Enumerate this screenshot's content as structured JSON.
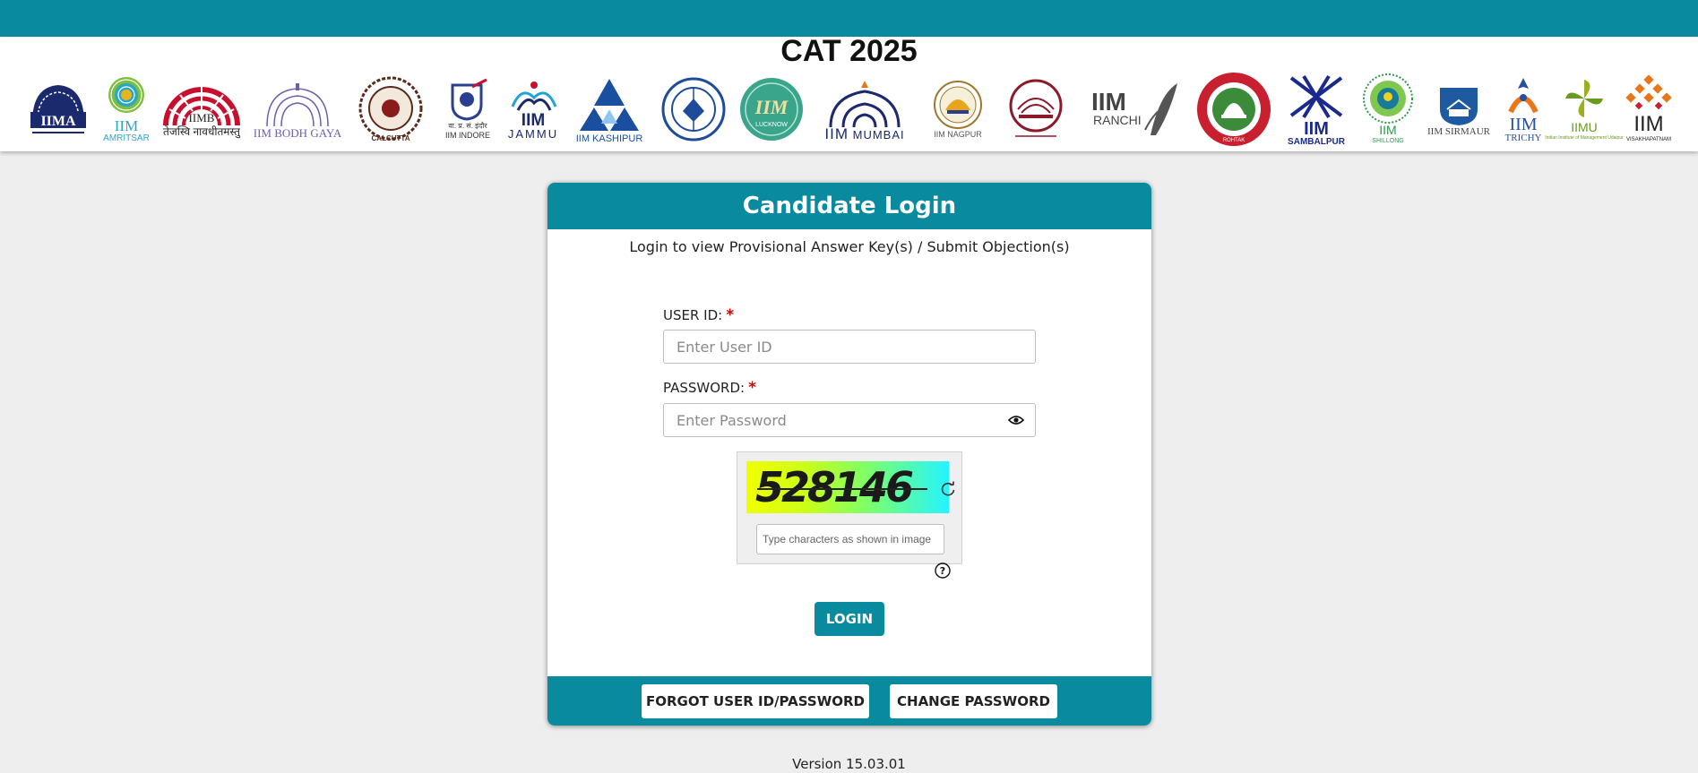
{
  "header": {
    "title": "CAT 2025",
    "logos": [
      {
        "name": "iima-logo",
        "text": "IIMA",
        "caption": ""
      },
      {
        "name": "iim-amritsar-logo",
        "text": "IIM",
        "caption": "AMRITSAR"
      },
      {
        "name": "iimb-logo",
        "text": "IIMB",
        "caption": "तेजस्वि नावधीतमस्तु"
      },
      {
        "name": "iim-bodh-gaya-logo",
        "text": "IIM BODH GAYA",
        "caption": ""
      },
      {
        "name": "iim-calcutta-logo",
        "text": "",
        "caption": "CALCUTTA"
      },
      {
        "name": "iim-indore-logo",
        "text": "",
        "caption": "IIM INDORE"
      },
      {
        "name": "iim-jammu-logo",
        "text": "IIM",
        "caption": "JAMMU"
      },
      {
        "name": "iim-kashipur-logo",
        "text": "",
        "caption": "IIM KASHIPUR"
      },
      {
        "name": "iim-kozhikode-logo",
        "text": "",
        "caption": ""
      },
      {
        "name": "iim-lucknow-logo",
        "text": "IIM",
        "caption": "LUCKNOW"
      },
      {
        "name": "iim-mumbai-logo",
        "text": "IIM",
        "caption": "MUMBAI"
      },
      {
        "name": "iim-nagpur-logo",
        "text": "",
        "caption": "IIM NAGPUR"
      },
      {
        "name": "iim-raipur-logo",
        "text": "",
        "caption": ""
      },
      {
        "name": "iim-ranchi-logo",
        "text": "IIM",
        "caption": "RANCHI"
      },
      {
        "name": "iim-rohtak-logo",
        "text": "",
        "caption": "ROHTAK"
      },
      {
        "name": "iim-sambalpur-logo",
        "text": "IIM",
        "caption": "SAMBALPUR"
      },
      {
        "name": "iim-shillong-logo",
        "text": "IIM",
        "caption": "SHILLONG"
      },
      {
        "name": "iim-sirmaur-logo",
        "text": "IIM SIRMAUR",
        "caption": ""
      },
      {
        "name": "iim-trichy-logo",
        "text": "IIM",
        "caption": "TRICHY"
      },
      {
        "name": "iim-udaipur-logo",
        "text": "IIMU",
        "caption": ""
      },
      {
        "name": "iim-visakhapatnam-logo",
        "text": "IIM",
        "caption": "VISAKHAPATNAM"
      }
    ]
  },
  "login": {
    "title": "Candidate Login",
    "subtitle": "Login to view Provisional Answer Key(s) / Submit Objection(s)",
    "user_id_label": "USER ID:",
    "user_id_placeholder": "Enter User ID",
    "password_label": "PASSWORD:",
    "password_placeholder": "Enter Password",
    "required_mark": "*",
    "captcha_value": "528146",
    "captcha_placeholder": "Type characters as shown in image",
    "login_button": "LOGIN",
    "forgot_button": "FORGOT USER ID/PASSWORD",
    "change_password_button": "CHANGE PASSWORD",
    "icons": {
      "show_password": "eye-icon",
      "refresh": "refresh-icon",
      "help": "help-icon"
    },
    "colors": {
      "primary": "#0a8a9f",
      "required": "#d40000",
      "background": "#eeeeee"
    }
  },
  "footer": {
    "version": "Version 15.03.01"
  }
}
